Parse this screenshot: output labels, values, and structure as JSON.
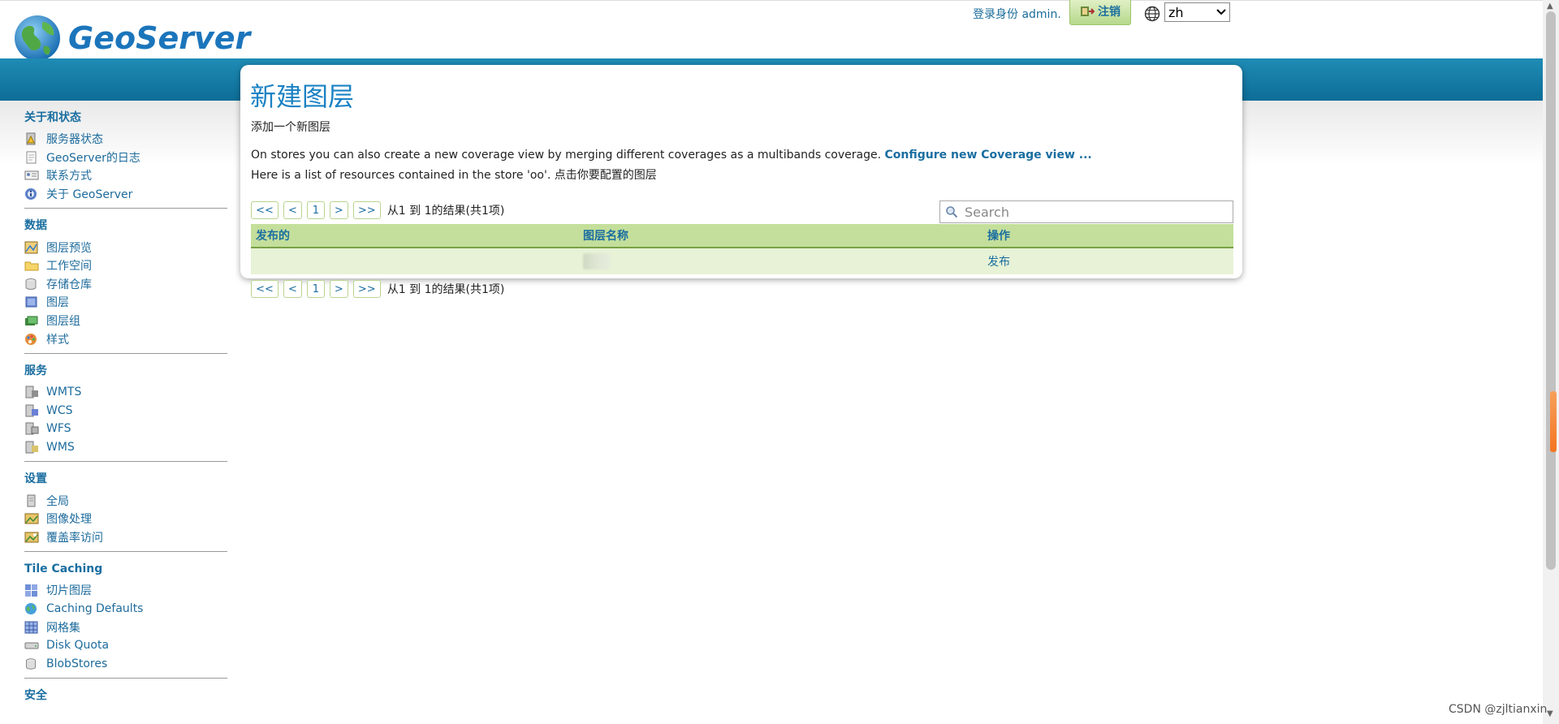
{
  "header": {
    "brand": "GeoServer",
    "login_text": "登录身份 admin.",
    "logout_label": "注销",
    "language": "zh"
  },
  "sidebar": {
    "sections": [
      {
        "title": "关于和状态",
        "items": [
          {
            "label": "服务器状态",
            "icon": "server-status-icon"
          },
          {
            "label": "GeoServer的日志",
            "icon": "log-document-icon"
          },
          {
            "label": "联系方式",
            "icon": "contact-card-icon"
          },
          {
            "label": "关于 GeoServer",
            "icon": "about-info-icon"
          }
        ]
      },
      {
        "title": "数据",
        "items": [
          {
            "label": "图层预览",
            "icon": "layer-preview-icon"
          },
          {
            "label": "工作空间",
            "icon": "folder-icon"
          },
          {
            "label": "存储仓库",
            "icon": "store-cylinder-icon"
          },
          {
            "label": "图层",
            "icon": "layer-icon"
          },
          {
            "label": "图层组",
            "icon": "layer-group-icon"
          },
          {
            "label": "样式",
            "icon": "palette-icon"
          }
        ]
      },
      {
        "title": "服务",
        "items": [
          {
            "label": "WMTS",
            "icon": "service-wmts-icon"
          },
          {
            "label": "WCS",
            "icon": "service-wcs-icon"
          },
          {
            "label": "WFS",
            "icon": "service-wfs-icon"
          },
          {
            "label": "WMS",
            "icon": "service-wms-icon"
          }
        ]
      },
      {
        "title": "设置",
        "items": [
          {
            "label": "全局",
            "icon": "global-settings-icon"
          },
          {
            "label": "图像处理",
            "icon": "image-processing-icon"
          },
          {
            "label": "覆盖率访问",
            "icon": "coverage-access-icon"
          }
        ]
      },
      {
        "title": "Tile Caching",
        "items": [
          {
            "label": "切片图层",
            "icon": "tile-layers-icon"
          },
          {
            "label": "Caching Defaults",
            "icon": "caching-globe-icon"
          },
          {
            "label": "网格集",
            "icon": "gridset-icon"
          },
          {
            "label": "Disk Quota",
            "icon": "disk-icon"
          },
          {
            "label": "BlobStores",
            "icon": "blobstore-icon"
          }
        ]
      },
      {
        "title": "安全",
        "items": []
      }
    ]
  },
  "main": {
    "title": "新建图层",
    "subtitle": "添加一个新图层",
    "line1_text": "On stores you can also create a new coverage view by merging different coverages as a multibands coverage.",
    "line1_link": "Configure new Coverage view ...",
    "line2_text": "Here is a list of resources contained in the store 'oo'. 点击你要配置的图层",
    "pager": {
      "first": "<<",
      "prev": "<",
      "page": "1",
      "next": ">",
      "last": ">>",
      "info": "从1 到 1的结果(共1项)"
    },
    "search_placeholder": "Search",
    "table": {
      "headers": [
        "发布的",
        "图层名称",
        "操作"
      ],
      "rows": [
        {
          "published": "",
          "layer_name": "",
          "action": "发布"
        }
      ]
    }
  },
  "watermark": "CSDN @zjltianxin"
}
